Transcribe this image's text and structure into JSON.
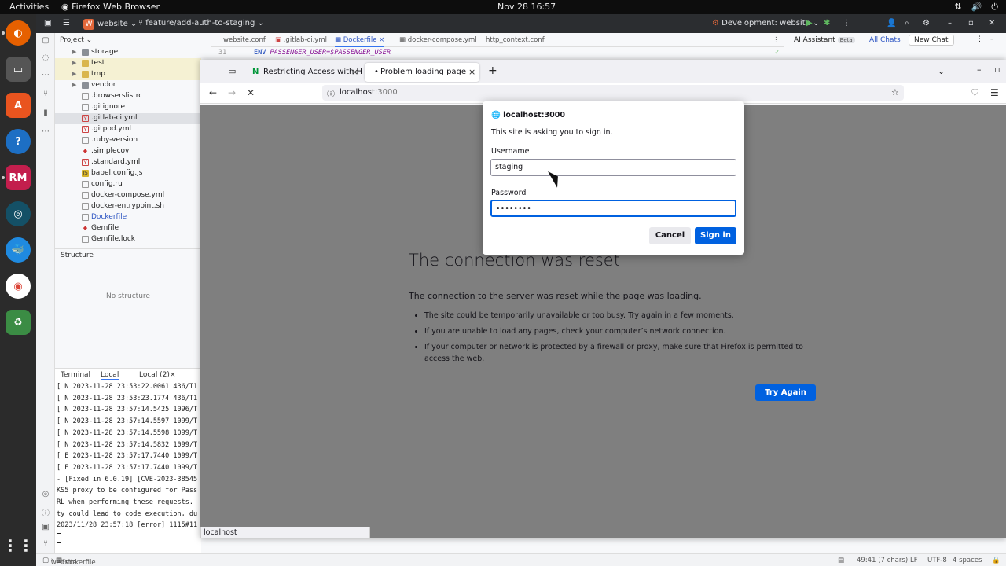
{
  "system": {
    "activities": "Activities",
    "app_name": "Firefox Web Browser",
    "clock": "Nov 28  16:57"
  },
  "ide": {
    "project_name": "website",
    "branch": "feature/add-auth-to-staging",
    "run_config": "Development: website",
    "project_panel_title": "Project",
    "tree": [
      {
        "label": "storage",
        "kind": "folder"
      },
      {
        "label": "test",
        "kind": "folder-hl"
      },
      {
        "label": "tmp",
        "kind": "folder-hl"
      },
      {
        "label": "vendor",
        "kind": "folder"
      },
      {
        "label": ".browserslistrc",
        "kind": "file"
      },
      {
        "label": ".gitignore",
        "kind": "file"
      },
      {
        "label": ".gitlab-ci.yml",
        "kind": "yml"
      },
      {
        "label": ".gitpod.yml",
        "kind": "yml"
      },
      {
        "label": ".ruby-version",
        "kind": "file"
      },
      {
        "label": ".simplecov",
        "kind": "ruby"
      },
      {
        "label": ".standard.yml",
        "kind": "yml"
      },
      {
        "label": "babel.config.js",
        "kind": "js"
      },
      {
        "label": "config.ru",
        "kind": "file"
      },
      {
        "label": "docker-compose.yml",
        "kind": "file"
      },
      {
        "label": "docker-entrypoint.sh",
        "kind": "file"
      },
      {
        "label": "Dockerfile",
        "kind": "docker"
      },
      {
        "label": "Gemfile",
        "kind": "ruby"
      },
      {
        "label": "Gemfile.lock",
        "kind": "file"
      }
    ],
    "structure_title": "Structure",
    "structure_empty": "No structure",
    "terminal_tabs": [
      "Terminal",
      "Local",
      "Local (2)"
    ],
    "terminal_lines": [
      "[ N 2023-11-28 23:53:22.0061 436/T1",
      "[ N 2023-11-28 23:53:23.1774 436/T1",
      "[ N 2023-11-28 23:57:14.5425 1096/T",
      "[ N 2023-11-28 23:57:14.5597 1099/T",
      "[ N 2023-11-28 23:57:14.5598 1099/T",
      "[ N 2023-11-28 23:57:14.5832 1099/T",
      "[ E 2023-11-28 23:57:17.7440 1099/T",
      "[ E 2023-11-28 23:57:17.7440 1099/T",
      "- [Fixed in 6.0.19] [CVE-2023-38545",
      "KS5 proxy to be configured for Pass",
      "RL when performing these requests.",
      "ty could lead to code execution, du",
      "2023/11/28 23:57:18 [error] 1115#11"
    ],
    "editor_tabs": [
      "website.conf",
      ".gitlab-ci.yml",
      "Dockerfile",
      "docker-compose.yml",
      "http_context.conf"
    ],
    "active_editor_tab": "Dockerfile",
    "code_line_number": "31",
    "code_line_keyword": "ENV",
    "code_line_text": "PASSENGER_USER=$PASSENGER_USER",
    "ai_assistant": "AI Assistant",
    "ai_beta": "Beta",
    "all_chats": "All Chats",
    "new_chat": "New Chat",
    "status_left_project": "website",
    "status_left_file": "Dockerfile",
    "status_position": "49:41 (7 chars)",
    "status_line_sep": "LF",
    "status_encoding": "UTF-8",
    "status_indent": "4 spaces"
  },
  "firefox": {
    "tabs": [
      {
        "title": "Restricting Access with H",
        "active": false
      },
      {
        "title": "Problem loading page",
        "active": true
      }
    ],
    "url_host": "localhost",
    "url_port": ":3000",
    "error_title": "The connection was reset",
    "error_desc": "The connection to the server was reset while the page was loading.",
    "error_items": [
      "The site could be temporarily unavailable or too busy. Try again in a few moments.",
      "If you are unable to load any pages, check your computer’s network connection.",
      "If your computer or network is protected by a firewall or proxy, make sure that Firefox is permitted to access the web."
    ],
    "try_again": "Try Again",
    "status_url": "localhost"
  },
  "auth_dialog": {
    "origin": "localhost:3000",
    "message": "This site is asking you to sign in.",
    "username_label": "Username",
    "username_value": "staging",
    "password_label": "Password",
    "password_value": "••••••••",
    "cancel": "Cancel",
    "sign_in": "Sign in"
  },
  "colors": {
    "accent": "#0061e0",
    "ide_dark": "#2b2d30",
    "highlight_folder": "#f5f1d3"
  }
}
